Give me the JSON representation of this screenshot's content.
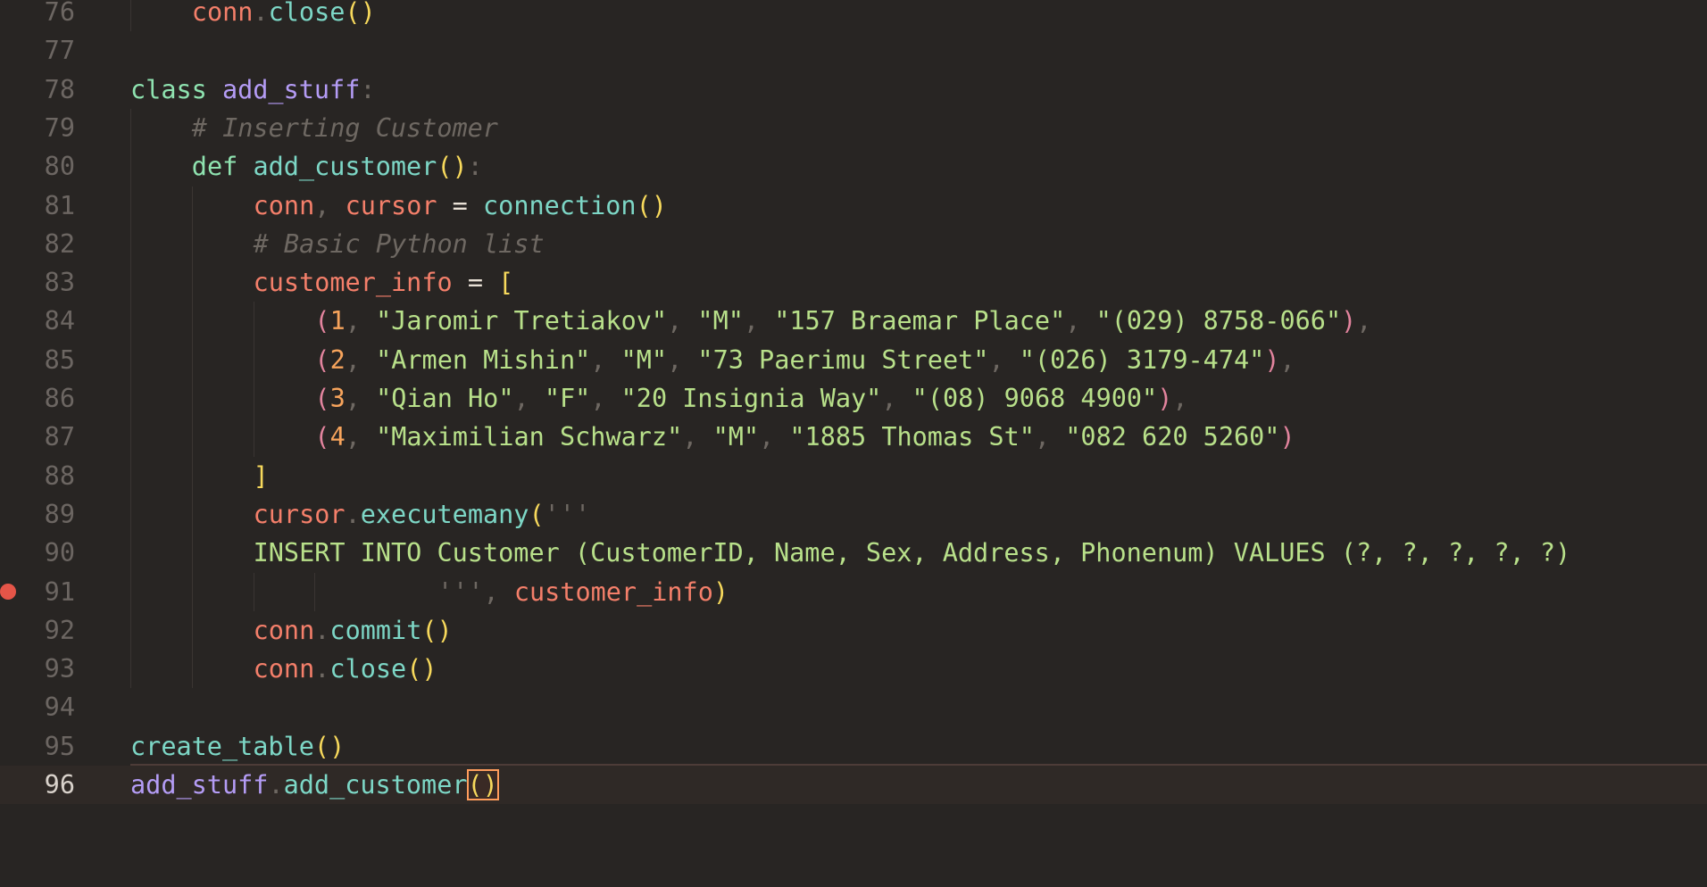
{
  "editor": {
    "active_line": 96,
    "breakpoint_line": 91,
    "colors": {
      "background": "#282523",
      "keyword": "#8fe3b0",
      "class_name": "#b49cf5",
      "function": "#7dd7c6",
      "variable": "#f47f6a",
      "string": "#b8e08a",
      "number": "#f7a45c",
      "comment": "#6e6862",
      "breakpoint": "#e55548"
    },
    "lines": [
      {
        "num": "76",
        "t": [
          {
            "c": "var",
            "v": "conn"
          },
          {
            "c": "pun",
            "v": "."
          },
          {
            "c": "fn",
            "v": "close"
          },
          {
            "c": "br1",
            "v": "()"
          }
        ]
      },
      {
        "num": "77",
        "t": []
      },
      {
        "num": "78",
        "t": [
          {
            "c": "kw",
            "v": "class "
          },
          {
            "c": "cls",
            "v": "add_stuff"
          },
          {
            "c": "pun",
            "v": ":"
          }
        ]
      },
      {
        "num": "79",
        "t": [
          {
            "c": "cm",
            "v": "# Inserting Customer"
          }
        ]
      },
      {
        "num": "80",
        "t": [
          {
            "c": "kw",
            "v": "def "
          },
          {
            "c": "fn",
            "v": "add_customer"
          },
          {
            "c": "br1",
            "v": "()"
          },
          {
            "c": "pun",
            "v": ":"
          }
        ]
      },
      {
        "num": "81",
        "t": [
          {
            "c": "var",
            "v": "conn"
          },
          {
            "c": "pun",
            "v": ", "
          },
          {
            "c": "var",
            "v": "cursor"
          },
          {
            "c": "op",
            "v": " = "
          },
          {
            "c": "fn",
            "v": "connection"
          },
          {
            "c": "br1",
            "v": "()"
          }
        ]
      },
      {
        "num": "82",
        "t": [
          {
            "c": "cm",
            "v": "# Basic Python list"
          }
        ]
      },
      {
        "num": "83",
        "t": [
          {
            "c": "var",
            "v": "customer_info"
          },
          {
            "c": "op",
            "v": " = "
          },
          {
            "c": "br1",
            "v": "["
          }
        ]
      },
      {
        "num": "84",
        "t": [
          {
            "c": "br2",
            "v": "("
          },
          {
            "c": "num",
            "v": "1"
          },
          {
            "c": "pun",
            "v": ", "
          },
          {
            "c": "str",
            "v": "\"Jaromir Tretiakov\""
          },
          {
            "c": "pun",
            "v": ", "
          },
          {
            "c": "str",
            "v": "\"M\""
          },
          {
            "c": "pun",
            "v": ", "
          },
          {
            "c": "str",
            "v": "\"157 Braemar Place\""
          },
          {
            "c": "pun",
            "v": ", "
          },
          {
            "c": "str",
            "v": "\"(029) 8758-066\""
          },
          {
            "c": "br2",
            "v": ")"
          },
          {
            "c": "pun",
            "v": ","
          }
        ]
      },
      {
        "num": "85",
        "t": [
          {
            "c": "br2",
            "v": "("
          },
          {
            "c": "num",
            "v": "2"
          },
          {
            "c": "pun",
            "v": ", "
          },
          {
            "c": "str",
            "v": "\"Armen Mishin\""
          },
          {
            "c": "pun",
            "v": ", "
          },
          {
            "c": "str",
            "v": "\"M\""
          },
          {
            "c": "pun",
            "v": ", "
          },
          {
            "c": "str",
            "v": "\"73 Paerimu Street\""
          },
          {
            "c": "pun",
            "v": ", "
          },
          {
            "c": "str",
            "v": "\"(026) 3179-474\""
          },
          {
            "c": "br2",
            "v": ")"
          },
          {
            "c": "pun",
            "v": ","
          }
        ]
      },
      {
        "num": "86",
        "t": [
          {
            "c": "br2",
            "v": "("
          },
          {
            "c": "num",
            "v": "3"
          },
          {
            "c": "pun",
            "v": ", "
          },
          {
            "c": "str",
            "v": "\"Qian Ho\""
          },
          {
            "c": "pun",
            "v": ", "
          },
          {
            "c": "str",
            "v": "\"F\""
          },
          {
            "c": "pun",
            "v": ", "
          },
          {
            "c": "str",
            "v": "\"20 Insignia Way\""
          },
          {
            "c": "pun",
            "v": ", "
          },
          {
            "c": "str",
            "v": "\"(08) 9068 4900\""
          },
          {
            "c": "br2",
            "v": ")"
          },
          {
            "c": "pun",
            "v": ","
          }
        ]
      },
      {
        "num": "87",
        "t": [
          {
            "c": "br2",
            "v": "("
          },
          {
            "c": "num",
            "v": "4"
          },
          {
            "c": "pun",
            "v": ", "
          },
          {
            "c": "str",
            "v": "\"Maximilian Schwarz\""
          },
          {
            "c": "pun",
            "v": ", "
          },
          {
            "c": "str",
            "v": "\"M\""
          },
          {
            "c": "pun",
            "v": ", "
          },
          {
            "c": "str",
            "v": "\"1885 Thomas St\""
          },
          {
            "c": "pun",
            "v": ", "
          },
          {
            "c": "str",
            "v": "\"082 620 5260\""
          },
          {
            "c": "br2",
            "v": ")"
          }
        ]
      },
      {
        "num": "88",
        "t": [
          {
            "c": "br1",
            "v": "]"
          }
        ]
      },
      {
        "num": "89",
        "t": [
          {
            "c": "var",
            "v": "cursor"
          },
          {
            "c": "pun",
            "v": "."
          },
          {
            "c": "fn",
            "v": "executemany"
          },
          {
            "c": "br1",
            "v": "("
          },
          {
            "c": "pun",
            "v": "'''"
          }
        ]
      },
      {
        "num": "90",
        "t": [
          {
            "c": "str",
            "v": "INSERT INTO Customer (CustomerID, Name, Sex, Address, Phonenum) VALUES (?, ?, ?, ?, ?)"
          }
        ]
      },
      {
        "num": "91",
        "t": [
          {
            "c": "pun",
            "v": "'''"
          },
          {
            "c": "pun",
            "v": ", "
          },
          {
            "c": "var",
            "v": "customer_info"
          },
          {
            "c": "br1",
            "v": ")"
          }
        ]
      },
      {
        "num": "92",
        "t": [
          {
            "c": "var",
            "v": "conn"
          },
          {
            "c": "pun",
            "v": "."
          },
          {
            "c": "fn",
            "v": "commit"
          },
          {
            "c": "br1",
            "v": "()"
          }
        ]
      },
      {
        "num": "93",
        "t": [
          {
            "c": "var",
            "v": "conn"
          },
          {
            "c": "pun",
            "v": "."
          },
          {
            "c": "fn",
            "v": "close"
          },
          {
            "c": "br1",
            "v": "()"
          }
        ]
      },
      {
        "num": "94",
        "t": []
      },
      {
        "num": "95",
        "t": [
          {
            "c": "fn",
            "v": "create_table"
          },
          {
            "c": "br1",
            "v": "()"
          }
        ]
      },
      {
        "num": "96",
        "t": [
          {
            "c": "cls",
            "v": "add_stuff"
          },
          {
            "c": "pun",
            "v": "."
          },
          {
            "c": "fn",
            "v": "add_customer"
          },
          {
            "c": "br1",
            "v": "()"
          }
        ]
      }
    ]
  }
}
